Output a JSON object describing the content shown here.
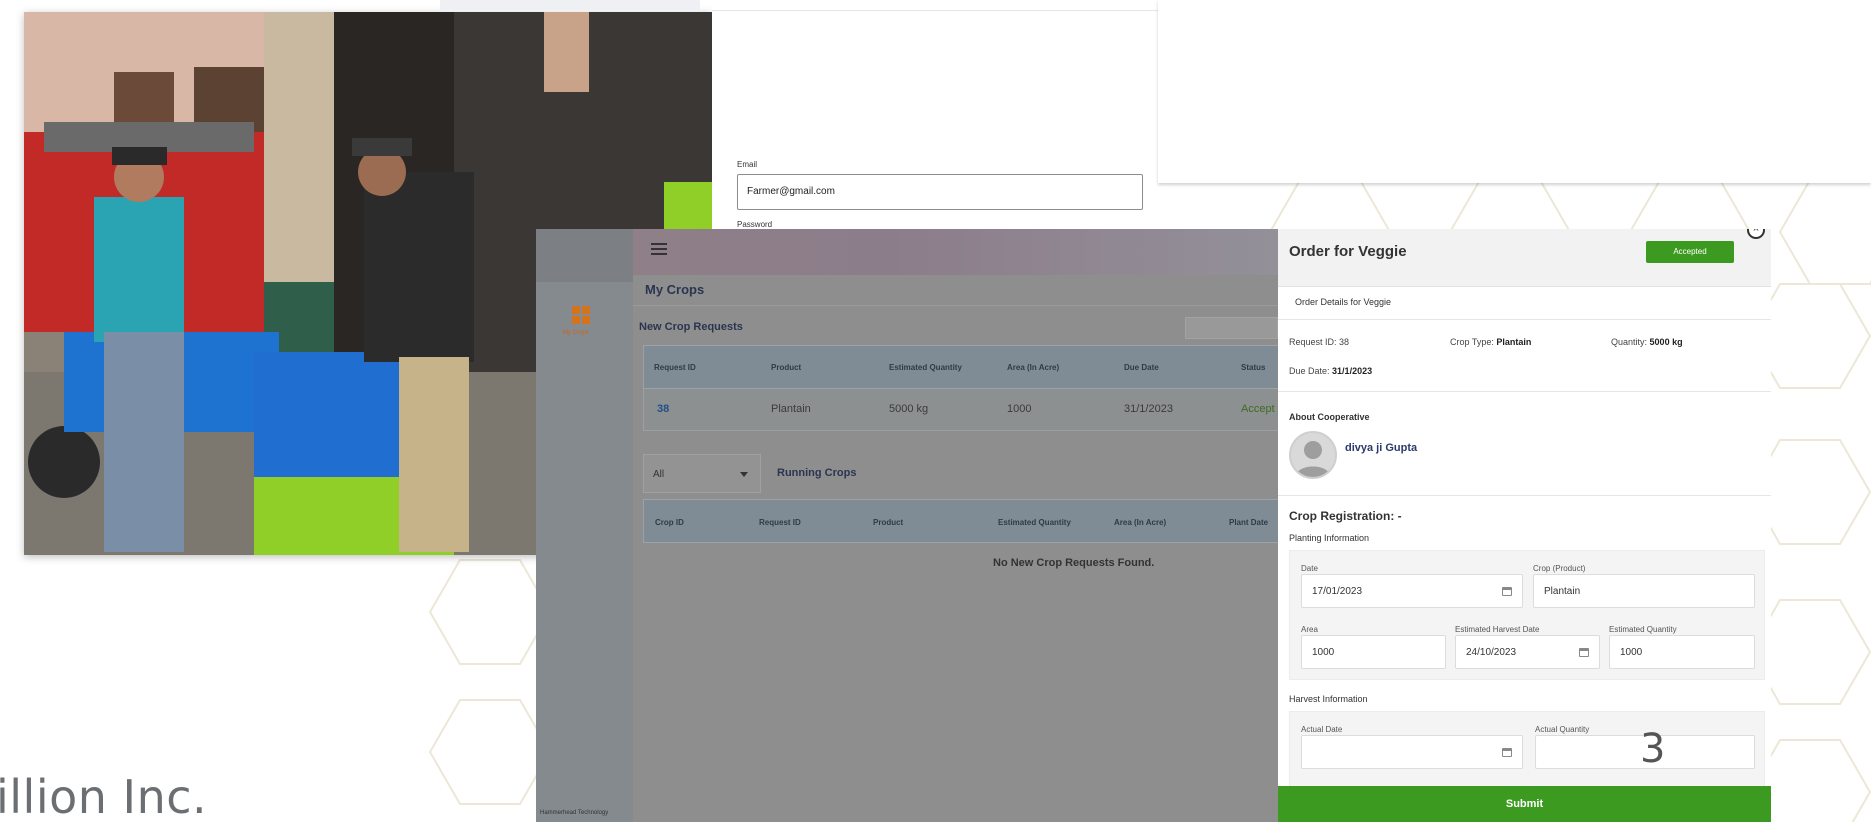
{
  "company": {
    "name": "illion Inc."
  },
  "page_number": "3",
  "login": {
    "email_label": "Email",
    "email_value": "Farmer@gmail.com",
    "password_label": "Password"
  },
  "app": {
    "sidebar": {
      "menu_label": "My Crops",
      "footer": "Hammerhead Technology"
    },
    "title": "My Crops",
    "new_requests": {
      "title": "New Crop Requests",
      "columns": [
        "Request ID",
        "Product",
        "Estimated Quantity",
        "Area (In Acre)",
        "Due Date",
        "Status"
      ],
      "rows": [
        {
          "request_id": "38",
          "product": "Plantain",
          "quantity": "5000 kg",
          "area": "1000",
          "due_date": "31/1/2023",
          "status": "Accept"
        }
      ]
    },
    "filter": {
      "selected": "All"
    },
    "running": {
      "title": "Running Crops",
      "columns": [
        "Crop ID",
        "Request ID",
        "Product",
        "Estimated Quantity",
        "Area (In Acre)",
        "Plant Date"
      ],
      "empty_message": "No New Crop Requests Found."
    }
  },
  "dialog": {
    "title": "Order for Veggie",
    "status": "Accepted",
    "subtitle": "Order Details for Veggie",
    "request_id_label": "Request ID:",
    "request_id": "38",
    "crop_type_label": "Crop Type:",
    "crop_type": "Plantain",
    "quantity_label": "Quantity:",
    "quantity": "5000 kg",
    "due_date_label": "Due Date:",
    "due_date": "31/1/2023",
    "about_label": "About Cooperative",
    "coop_name": "divya ji Gupta",
    "crop_registration": "Crop Registration: -",
    "planting": {
      "title": "Planting Information",
      "date_label": "Date",
      "date": "17/01/2023",
      "crop_label": "Crop (Product)",
      "crop": "Plantain",
      "area_label": "Area",
      "area": "1000",
      "harvest_date_label": "Estimated Harvest Date",
      "harvest_date": "24/10/2023",
      "est_qty_label": "Estimated Quantity",
      "est_qty": "1000"
    },
    "harvest": {
      "title": "Harvest Information",
      "actual_date_label": "Actual Date",
      "actual_date": "",
      "actual_qty_label": "Actual Quantity",
      "actual_qty": ""
    },
    "submit_label": "Submit"
  }
}
